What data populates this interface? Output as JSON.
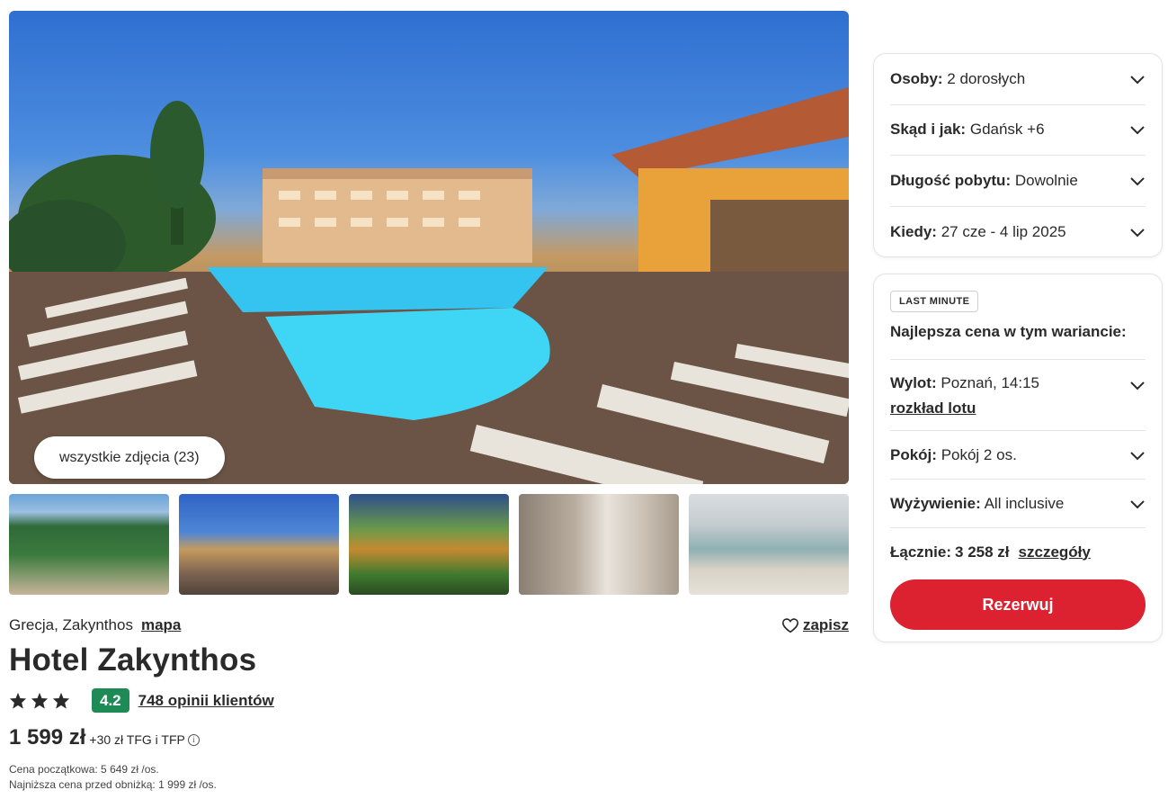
{
  "gallery": {
    "all_photos_label": "wszystkie zdjęcia (23)",
    "thumbnails": [
      "hotel-aerial-thumbnail",
      "pool-evening-thumbnail",
      "garden-night-thumbnail",
      "room-thumbnail",
      "lobby-thumbnail"
    ]
  },
  "hotel": {
    "location": "Grecja, Zakynthos",
    "map_label": "mapa",
    "save_label": "zapisz",
    "name": "Hotel Zakynthos",
    "stars": 3,
    "score": "4.2",
    "reviews_label": "748 opinii klientów",
    "price": "1 599 zł",
    "price_extra": "+30 zł TFG i TFP",
    "initial_price_note": "Cena początkowa: 5 649 zł /os.",
    "lowest_price_note": "Najniższa cena przed obniżką: 1 999 zł /os."
  },
  "search_panel": {
    "rows": [
      {
        "label": "Osoby:",
        "value": "2 dorosłych"
      },
      {
        "label": "Skąd i jak:",
        "value": "Gdańsk +6"
      },
      {
        "label": "Długość pobytu:",
        "value": "Dowolnie"
      },
      {
        "label": "Kiedy:",
        "value": "27 cze - 4 lip 2025"
      }
    ]
  },
  "offer_panel": {
    "badge": "LAST MINUTE",
    "best_price_label": "Najlepsza cena w tym wariancie:",
    "flight_label": "Wylot:",
    "flight_value": "Poznań, 14:15",
    "flight_link": "rozkład lotu",
    "room_label": "Pokój:",
    "room_value": "Pokój 2 os.",
    "board_label": "Wyżywienie:",
    "board_value": "All inclusive",
    "total_label": "Łącznie:",
    "total_value": "3 258 zł",
    "details_label": "szczegóły",
    "reserve_label": "Rezerwuj"
  },
  "colors": {
    "accent": "#dc2230",
    "score_badge": "#1e8a55",
    "text": "#2a2a2a"
  }
}
